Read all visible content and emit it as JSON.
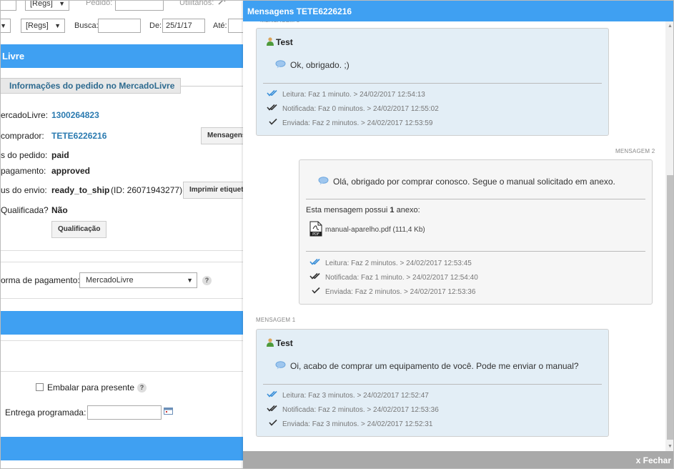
{
  "background": {
    "top_regs_1": "[Regs]",
    "pedido_label": "Pedido:",
    "utilitarios_label": "Utilitários:",
    "regs_2": "[Regs]",
    "busca_label": "Busca:",
    "de_label": "De:",
    "de_value": "25/1/17",
    "ate_label": "Até:",
    "section_title": "Livre",
    "tab_title": "Informações do pedido no MercadoLivre",
    "rows": [
      {
        "label": "ercadoLivre:",
        "value": "1300264823"
      },
      {
        "label": "comprador:",
        "value": "TETE6226216"
      },
      {
        "label": "s do pedido:",
        "value": "paid"
      },
      {
        "label": "pagamento:",
        "value": "approved"
      },
      {
        "label": "us do envio:",
        "value": "ready_to_ship",
        "extra": "(ID: 26071943277)"
      },
      {
        "label": "Qualificada?",
        "value": "Não"
      }
    ],
    "mensagens_button": "Mensagens",
    "imprimir_button": "Imprimir etiqueta",
    "qualificacao_button": "Qualificação",
    "forma_pagamento_label": "orma de pagamento:",
    "forma_pagamento_value": "MercadoLivre",
    "embalar_label": "Embalar para presente",
    "entrega_label": "Entrega programada:"
  },
  "modal": {
    "title": "Mensagens TETE6226216",
    "close_label": "x Fechar",
    "messages": [
      {
        "sender": "Test",
        "text": "Ok, obrigado. ;)",
        "statuses": [
          "Leitura: Faz 1 minuto. > 24/02/2017 12:54:13",
          "Notificada: Faz 0 minutos. > 24/02/2017 12:55:02",
          "Enviada: Faz 2 minutos. > 24/02/2017 12:53:59"
        ]
      },
      {
        "label": "MENSAGEM 2",
        "text": "Olá, obrigado por comprar conosco. Segue o manual solicitado em anexo.",
        "attachment_prefix": "Esta mensagem possui",
        "attachment_count": "1",
        "attachment_suffix": "anexo:",
        "file": "manual-aparelho.pdf (111,4 Kb)",
        "statuses": [
          "Leitura: Faz 2 minutos. > 24/02/2017 12:53:45",
          "Notificada: Faz 1 minuto. > 24/02/2017 12:54:40",
          "Enviada: Faz 2 minutos. > 24/02/2017 12:53:36"
        ]
      },
      {
        "label": "MENSAGEM 1",
        "sender": "Test",
        "text": "Oi, acabo de comprar um equipamento de você. Pode me enviar o manual?",
        "statuses": [
          "Leitura: Faz 3 minutos. > 24/02/2017 12:52:47",
          "Notificada: Faz 2 minutos. > 24/02/2017 12:53:36",
          "Enviada: Faz 3 minutos. > 24/02/2017 12:52:31"
        ]
      }
    ]
  },
  "colors": {
    "accent": "#3fa0f2",
    "read_check": "#3a8fd8",
    "card_left": "#e3eef6",
    "card_right": "#f6f6f6"
  }
}
